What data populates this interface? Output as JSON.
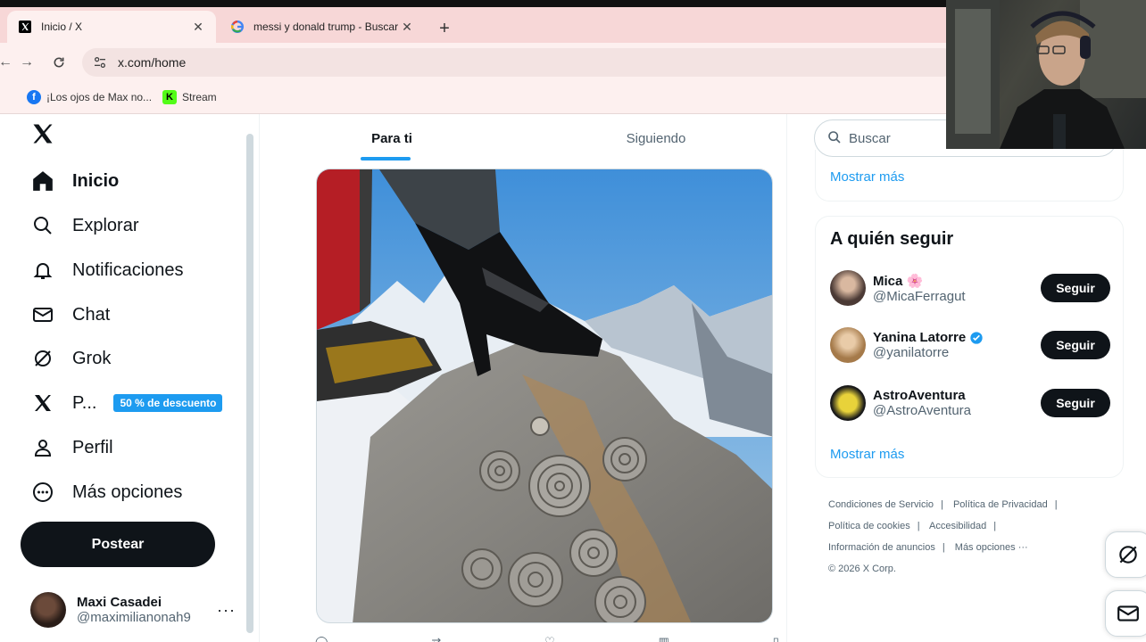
{
  "browser": {
    "tabs": [
      {
        "title": "Inicio / X",
        "active": true,
        "favicon": "x-logo-icon"
      },
      {
        "title": "messi y donald trump - Buscar",
        "active": false,
        "favicon": "google-icon"
      }
    ],
    "address": "x.com/home",
    "bookmarks": [
      {
        "label": "¡Los ojos de Max no...",
        "icon": "facebook-icon",
        "color": "#1877f2"
      },
      {
        "label": "Stream",
        "icon": "kick-icon",
        "color": "#53fc18"
      }
    ]
  },
  "nav": {
    "items": [
      {
        "label": "Inicio",
        "icon": "home-icon"
      },
      {
        "label": "Explorar",
        "icon": "search-icon"
      },
      {
        "label": "Notificaciones",
        "icon": "bell-icon"
      },
      {
        "label": "Chat",
        "icon": "mail-icon"
      },
      {
        "label": "Grok",
        "icon": "grok-icon"
      },
      {
        "label": "P...",
        "icon": "x-premium-icon"
      },
      {
        "label": "Perfil",
        "icon": "person-icon"
      },
      {
        "label": "Más opciones",
        "icon": "more-circle-icon"
      }
    ],
    "promo_badge": "50 % de descuento",
    "post_label": "Postear",
    "account": {
      "name": "Maxi Casadei",
      "handle": "@maximilianonah9"
    }
  },
  "feed": {
    "tabs": [
      {
        "label": "Para ti",
        "active": true
      },
      {
        "label": "Siguiendo",
        "active": false
      }
    ]
  },
  "right": {
    "search_placeholder": "Buscar",
    "show_more_top": "Mostrar más",
    "who_to_follow": {
      "title": "A quién seguir",
      "users": [
        {
          "name": "Mica 🌸",
          "handle": "@MicaFerragut",
          "verified": false,
          "button": "Seguir",
          "avatar_color": "#6a7f8a"
        },
        {
          "name": "Yanina Latorre",
          "handle": "@yanilatorre",
          "verified": true,
          "button": "Seguir",
          "avatar_color": "#c49a6c"
        },
        {
          "name": "AstroAventura",
          "handle": "@AstroAventura",
          "verified": false,
          "button": "Seguir",
          "avatar_color": "#e8d23a"
        }
      ],
      "show_more": "Mostrar más"
    },
    "footer": {
      "links": [
        "Condiciones de Servicio",
        "Política de Privacidad",
        "Política de cookies",
        "Accesibilidad",
        "Información de anuncios",
        "Más opciones ···"
      ],
      "copyright": "© 2026 X Corp."
    }
  },
  "colors": {
    "accent": "#1d9bf0",
    "text": "#0f1419",
    "muted": "#536471",
    "tabstrip": "#f7d7d7"
  }
}
